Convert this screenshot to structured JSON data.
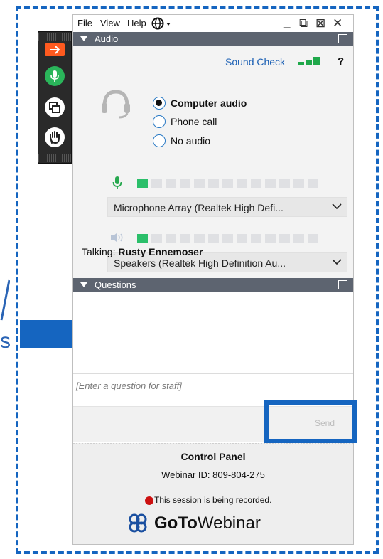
{
  "menu": {
    "file": "File",
    "view": "View",
    "help": "Help"
  },
  "window_controls": {
    "minimize": "_",
    "restore": "⧉",
    "popout": "⊠",
    "close": "✕"
  },
  "audio": {
    "section_title": "Audio",
    "sound_check": "Sound Check",
    "help_mark": "?",
    "options": [
      {
        "label": "Computer audio",
        "selected": true
      },
      {
        "label": "Phone call",
        "selected": false
      },
      {
        "label": "No audio",
        "selected": false
      }
    ],
    "microphone": "Microphone Array (Realtek High Defi...",
    "microphone_level": 1,
    "speakers": "Speakers (Realtek High Definition Au...",
    "speaker_level": 1,
    "meter_cells": 13,
    "talking_label": "Talking:",
    "talking_name": "Rusty Ennemoser"
  },
  "questions": {
    "section_title": "Questions",
    "input_placeholder": "[Enter a question for staff]",
    "send_label": "Send"
  },
  "footer": {
    "title": "Control Panel",
    "webinar_id": "Webinar ID: 809-804-275",
    "recording": "This session is being recorded.",
    "brand_goto": "GoTo",
    "brand_webinar": "Webinar"
  },
  "colors": {
    "accent_blue": "#1565c0",
    "section_bar": "#5d6470",
    "meter_green": "#2bbf6a",
    "link_blue": "#1a5fb4",
    "record_red": "#cc1010"
  },
  "icons": {
    "toolbar": [
      "arrow-right-icon",
      "microphone-icon",
      "screen-share-icon",
      "raise-hand-icon"
    ],
    "language": "globe-icon"
  }
}
